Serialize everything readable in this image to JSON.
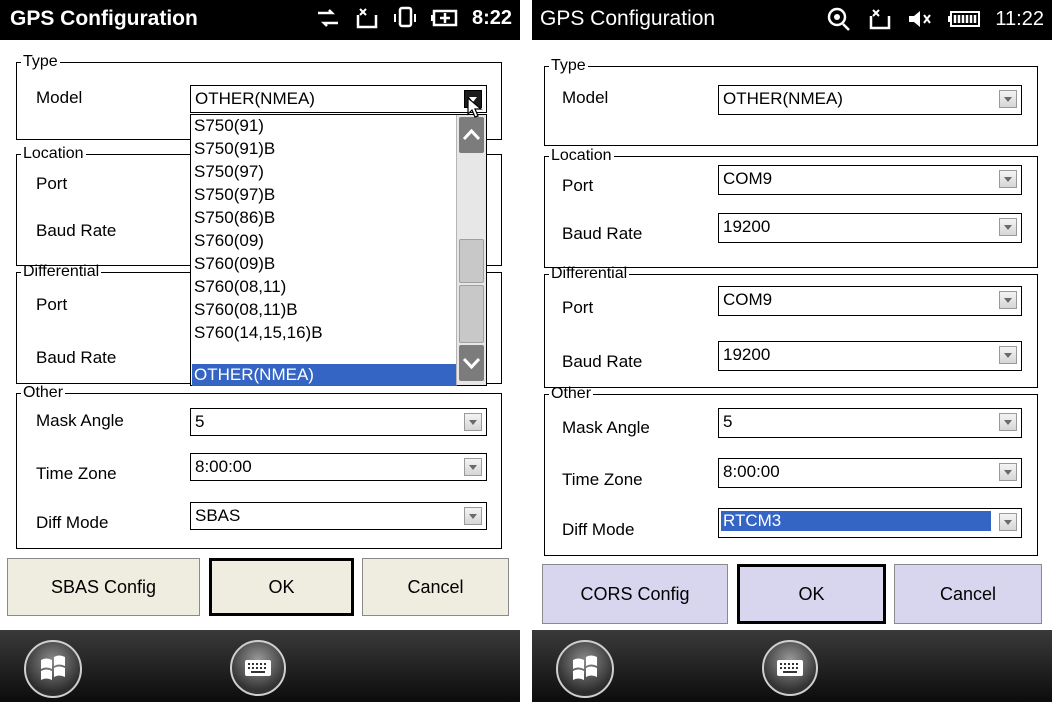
{
  "left": {
    "status": {
      "title": "GPS Configuration",
      "time": "8:22"
    },
    "type_group": {
      "legend": "Type",
      "model_label": "Model",
      "model_value": "OTHER(NMEA)"
    },
    "location_group": {
      "legend": "Location",
      "port_label": "Port",
      "baud_label": "Baud Rate"
    },
    "differential_group": {
      "legend": "Differential",
      "port_label": "Port",
      "baud_label": "Baud Rate"
    },
    "other_group": {
      "legend": "Other",
      "mask_label": "Mask Angle",
      "mask_value": "5",
      "tz_label": "Time Zone",
      "tz_value": "8:00:00",
      "diff_label": "Diff Mode",
      "diff_value": "SBAS"
    },
    "buttons": {
      "config": "SBAS Config",
      "ok": "OK",
      "cancel": "Cancel"
    },
    "model_dropdown": {
      "options": [
        "S750(91)",
        "S750(91)B",
        "S750(97)",
        "S750(97)B",
        "S750(86)B",
        "S760(09)",
        "S760(09)B",
        "S760(08,11)",
        "S760(08,11)B",
        "S760(14,15,16)B",
        "OTHER(NMEA)"
      ],
      "selected": "OTHER(NMEA)"
    }
  },
  "right": {
    "status": {
      "title": "GPS Configuration",
      "time": "11:22"
    },
    "type_group": {
      "legend": "Type",
      "model_label": "Model",
      "model_value": "OTHER(NMEA)"
    },
    "location_group": {
      "legend": "Location",
      "port_label": "Port",
      "port_value": "COM9",
      "baud_label": "Baud Rate",
      "baud_value": "19200"
    },
    "differential_group": {
      "legend": "Differential",
      "port_label": "Port",
      "port_value": "COM9",
      "baud_label": "Baud Rate",
      "baud_value": "19200"
    },
    "other_group": {
      "legend": "Other",
      "mask_label": "Mask Angle",
      "mask_value": "5",
      "tz_label": "Time Zone",
      "tz_value": "8:00:00",
      "diff_label": "Diff Mode",
      "diff_value": "RTCM3"
    },
    "buttons": {
      "config": "CORS Config",
      "ok": "OK",
      "cancel": "Cancel"
    }
  },
  "colors": {
    "left_button_bg": "#efeddf",
    "right_button_bg": "#d8d6ee",
    "selection": "#3464c4",
    "titlebar": "#000000"
  },
  "icons": [
    "sync-icon",
    "message-icon",
    "vibrate-icon",
    "battery-charging-icon",
    "gps-icon",
    "speaker-mute-icon",
    "battery-icon",
    "windows-start-icon",
    "keyboard-icon"
  ]
}
